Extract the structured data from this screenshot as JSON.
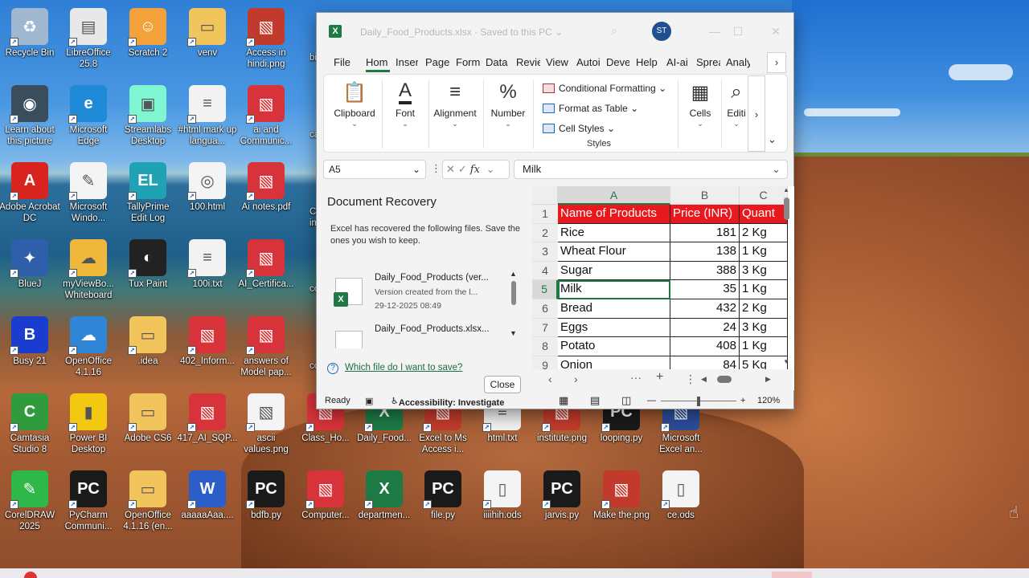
{
  "desktop": {
    "icons": [
      {
        "label": "Recycle Bin",
        "icon": "recycle-bin-icon",
        "color": "#9fb8d0"
      },
      {
        "label": "LibreOffice 25.8",
        "icon": "libreoffice-icon",
        "color": "#e8e8e8"
      },
      {
        "label": "Scratch 2",
        "icon": "scratch-cat-icon",
        "color": "#f3a23a"
      },
      {
        "label": "venv",
        "icon": "folder-icon",
        "color": "#f2c55c"
      },
      {
        "label": "Access in hindi.png",
        "icon": "image-file-icon",
        "color": "#c23a2b"
      },
      {
        "label": "Learn about this picture",
        "icon": "camera-icon",
        "color": "#3a4d5c"
      },
      {
        "label": "Microsoft Edge",
        "icon": "edge-icon",
        "color": "#1f8ad8"
      },
      {
        "label": "Streamlabs Desktop",
        "icon": "streamlabs-icon",
        "color": "#80f5d2"
      },
      {
        "label": "#html mark up langua...",
        "icon": "text-file-icon",
        "color": "#f2f2f2"
      },
      {
        "label": "ai and Communic...",
        "icon": "pdf-file-icon",
        "color": "#d8333a"
      },
      {
        "label": "Adobe Acrobat DC",
        "icon": "acrobat-icon",
        "color": "#d8231f"
      },
      {
        "label": "Microsoft Windo...",
        "icon": "whiteboard-icon",
        "color": "#f4f4f4"
      },
      {
        "label": "TallyPrime Edit Log",
        "icon": "tallyprime-icon",
        "color": "#1fa3b4"
      },
      {
        "label": "100.html",
        "icon": "chrome-html-icon",
        "color": "#f4f4f4"
      },
      {
        "label": "Ai notes.pdf",
        "icon": "pdf-file-icon",
        "color": "#d8333a"
      },
      {
        "label": "BlueJ",
        "icon": "bluej-bird-icon",
        "color": "#2f5faa"
      },
      {
        "label": "myViewBo... Whiteboard",
        "icon": "myviewboard-icon",
        "color": "#f0b83a"
      },
      {
        "label": "Tux Paint",
        "icon": "tux-penguin-icon",
        "color": "#222222"
      },
      {
        "label": "100i.txt",
        "icon": "text-file-icon",
        "color": "#f2f2f2"
      },
      {
        "label": "AI_Certifica...",
        "icon": "pdf-file-icon",
        "color": "#d8333a"
      },
      {
        "label": "Busy 21",
        "icon": "busy-icon",
        "color": "#1b3dcf"
      },
      {
        "label": "OpenOffice 4.1.16",
        "icon": "openoffice-icon",
        "color": "#2f86d6"
      },
      {
        "label": ".idea",
        "icon": "folder-icon",
        "color": "#f2c55c"
      },
      {
        "label": "402_Inform...",
        "icon": "pdf-file-icon",
        "color": "#d8333a"
      },
      {
        "label": "answers of Model pap...",
        "icon": "pdf-file-icon",
        "color": "#d8333a"
      },
      {
        "label": "Camtasia Studio 8",
        "icon": "camtasia-icon",
        "color": "#2f9b3c"
      },
      {
        "label": "Power BI Desktop",
        "icon": "powerbi-icon",
        "color": "#f2c811"
      },
      {
        "label": "Adobe CS6",
        "icon": "folder-icon",
        "color": "#f2c55c"
      },
      {
        "label": "417_AI_SQP...",
        "icon": "pdf-file-icon",
        "color": "#d8333a"
      },
      {
        "label": "ascii values.png",
        "icon": "image-file-icon",
        "color": "#f4f4f4"
      },
      {
        "label": "Class_Ho...",
        "icon": "pdf-file-icon",
        "color": "#d8333a"
      },
      {
        "label": "Daily_Food...",
        "icon": "excel-file-icon",
        "color": "#1d7a44"
      },
      {
        "label": "Excel to Ms Access i...",
        "icon": "image-file-icon",
        "color": "#c23a2b"
      },
      {
        "label": "html.txt",
        "icon": "text-file-icon",
        "color": "#f2f2f2"
      },
      {
        "label": "institute.png",
        "icon": "image-file-icon",
        "color": "#c23a2b"
      },
      {
        "label": "looping.py",
        "icon": "pycharm-file-icon",
        "color": "#1a1a1a"
      },
      {
        "label": "Microsoft Excel an...",
        "icon": "image-file-icon",
        "color": "#2a4d9a"
      },
      {
        "label": "CorelDRAW 2025",
        "icon": "coreldraw-icon",
        "color": "#2fb84a"
      },
      {
        "label": "PyCharm Communi...",
        "icon": "pycharm-icon",
        "color": "#1a1a1a"
      },
      {
        "label": "OpenOffice 4.1.16 (en...",
        "icon": "folder-icon",
        "color": "#f2c55c"
      },
      {
        "label": "aaaaaAaa....",
        "icon": "word-file-icon",
        "color": "#2b5ec9"
      },
      {
        "label": "bdfb.py",
        "icon": "pycharm-file-icon",
        "color": "#1a1a1a"
      },
      {
        "label": "Computer...",
        "icon": "pdf-file-icon",
        "color": "#d8333a"
      },
      {
        "label": "departmen...",
        "icon": "excel-file-icon",
        "color": "#1d7a44"
      },
      {
        "label": "file.py",
        "icon": "pycharm-file-icon",
        "color": "#1a1a1a"
      },
      {
        "label": "iiiihih.ods",
        "icon": "ods-file-icon",
        "color": "#f4f4f4"
      },
      {
        "label": "jarvis.py",
        "icon": "pycharm-file-icon",
        "color": "#1a1a1a"
      },
      {
        "label": "Make the.png",
        "icon": "image-file-icon",
        "color": "#c23a2b"
      },
      {
        "label": "ce.ods",
        "icon": "ods-file-icon",
        "color": "#f4f4f4"
      }
    ],
    "partial_labels": [
      "bi",
      "casc",
      "CC impl",
      "cc",
      "cc"
    ]
  },
  "excel": {
    "title": "Daily_Food_Products.xlsx  ·  Saved to this PC",
    "title_suffix": "⌄",
    "user_initials": "ST",
    "menu_tabs": [
      "File",
      "Hom",
      "Inser",
      "Page",
      "Form",
      "Data",
      "Revie",
      "View",
      "Autoi",
      "Deve",
      "Help",
      "AI-ai",
      "Sprea",
      "Analy"
    ],
    "ribbon": {
      "clipboard": "Clipboard",
      "font": "Font",
      "alignment": "Alignment",
      "number": "Number",
      "conditional_formatting": "Conditional Formatting",
      "format_as_table": "Format as Table",
      "cell_styles": "Cell Styles",
      "styles": "Styles",
      "cells": "Cells",
      "editing": "Editi"
    },
    "name_box": "A5",
    "formula_value": "Milk",
    "fx_label": "fx",
    "recovery": {
      "title": "Document Recovery",
      "description": "Excel has recovered the following files.  Save the ones you wish to keep.",
      "files": [
        {
          "name": "Daily_Food_Products (ver...",
          "sub": "Version created from the l...",
          "date": "29-12-2025 08:49"
        },
        {
          "name": "Daily_Food_Products.xlsx...",
          "sub": "",
          "date": ""
        }
      ],
      "help_link": "Which file do I want to save?",
      "close_label": "Close"
    },
    "sheet": {
      "columns": [
        "A",
        "B",
        "C"
      ],
      "rows": [
        "1",
        "2",
        "3",
        "4",
        "5",
        "6",
        "7",
        "8",
        "9"
      ],
      "header": [
        "Name of Products",
        "Price (INR)",
        "Quant"
      ],
      "data": [
        [
          "Rice",
          "181",
          "2 Kg"
        ],
        [
          "Wheat Flour",
          "138",
          "1 Kg"
        ],
        [
          "Sugar",
          "388",
          "3 Kg"
        ],
        [
          "Milk",
          "35",
          "1 Kg"
        ],
        [
          "Bread",
          "432",
          "2 Kg"
        ],
        [
          "Eggs",
          "24",
          "3 Kg"
        ],
        [
          "Potato",
          "408",
          "1 Kg"
        ],
        [
          "Onion",
          "84",
          "5 Kg"
        ]
      ],
      "header_color": "#e8181f",
      "selected_cell": "A5"
    },
    "status": {
      "ready": "Ready",
      "accessibility": "Accessibility: Investigate",
      "zoom": "120%"
    }
  }
}
